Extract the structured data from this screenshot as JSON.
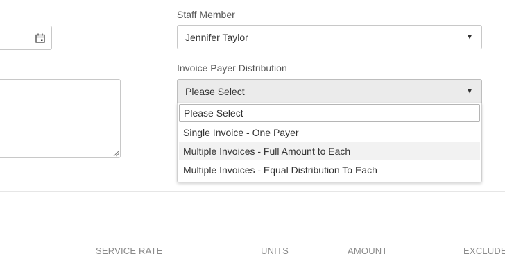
{
  "staff": {
    "label": "Staff Member",
    "value": "Jennifer Taylor"
  },
  "distribution": {
    "label": "Invoice Payer Distribution",
    "value": "Please Select",
    "options": [
      "Please Select",
      "Single Invoice - One Payer",
      "Multiple Invoices - Full Amount to Each",
      "Multiple Invoices - Equal Distribution To Each"
    ]
  },
  "table": {
    "columns": [
      "SERVICE RATE",
      "UNITS",
      "AMOUNT",
      "EXCLUDE"
    ]
  }
}
